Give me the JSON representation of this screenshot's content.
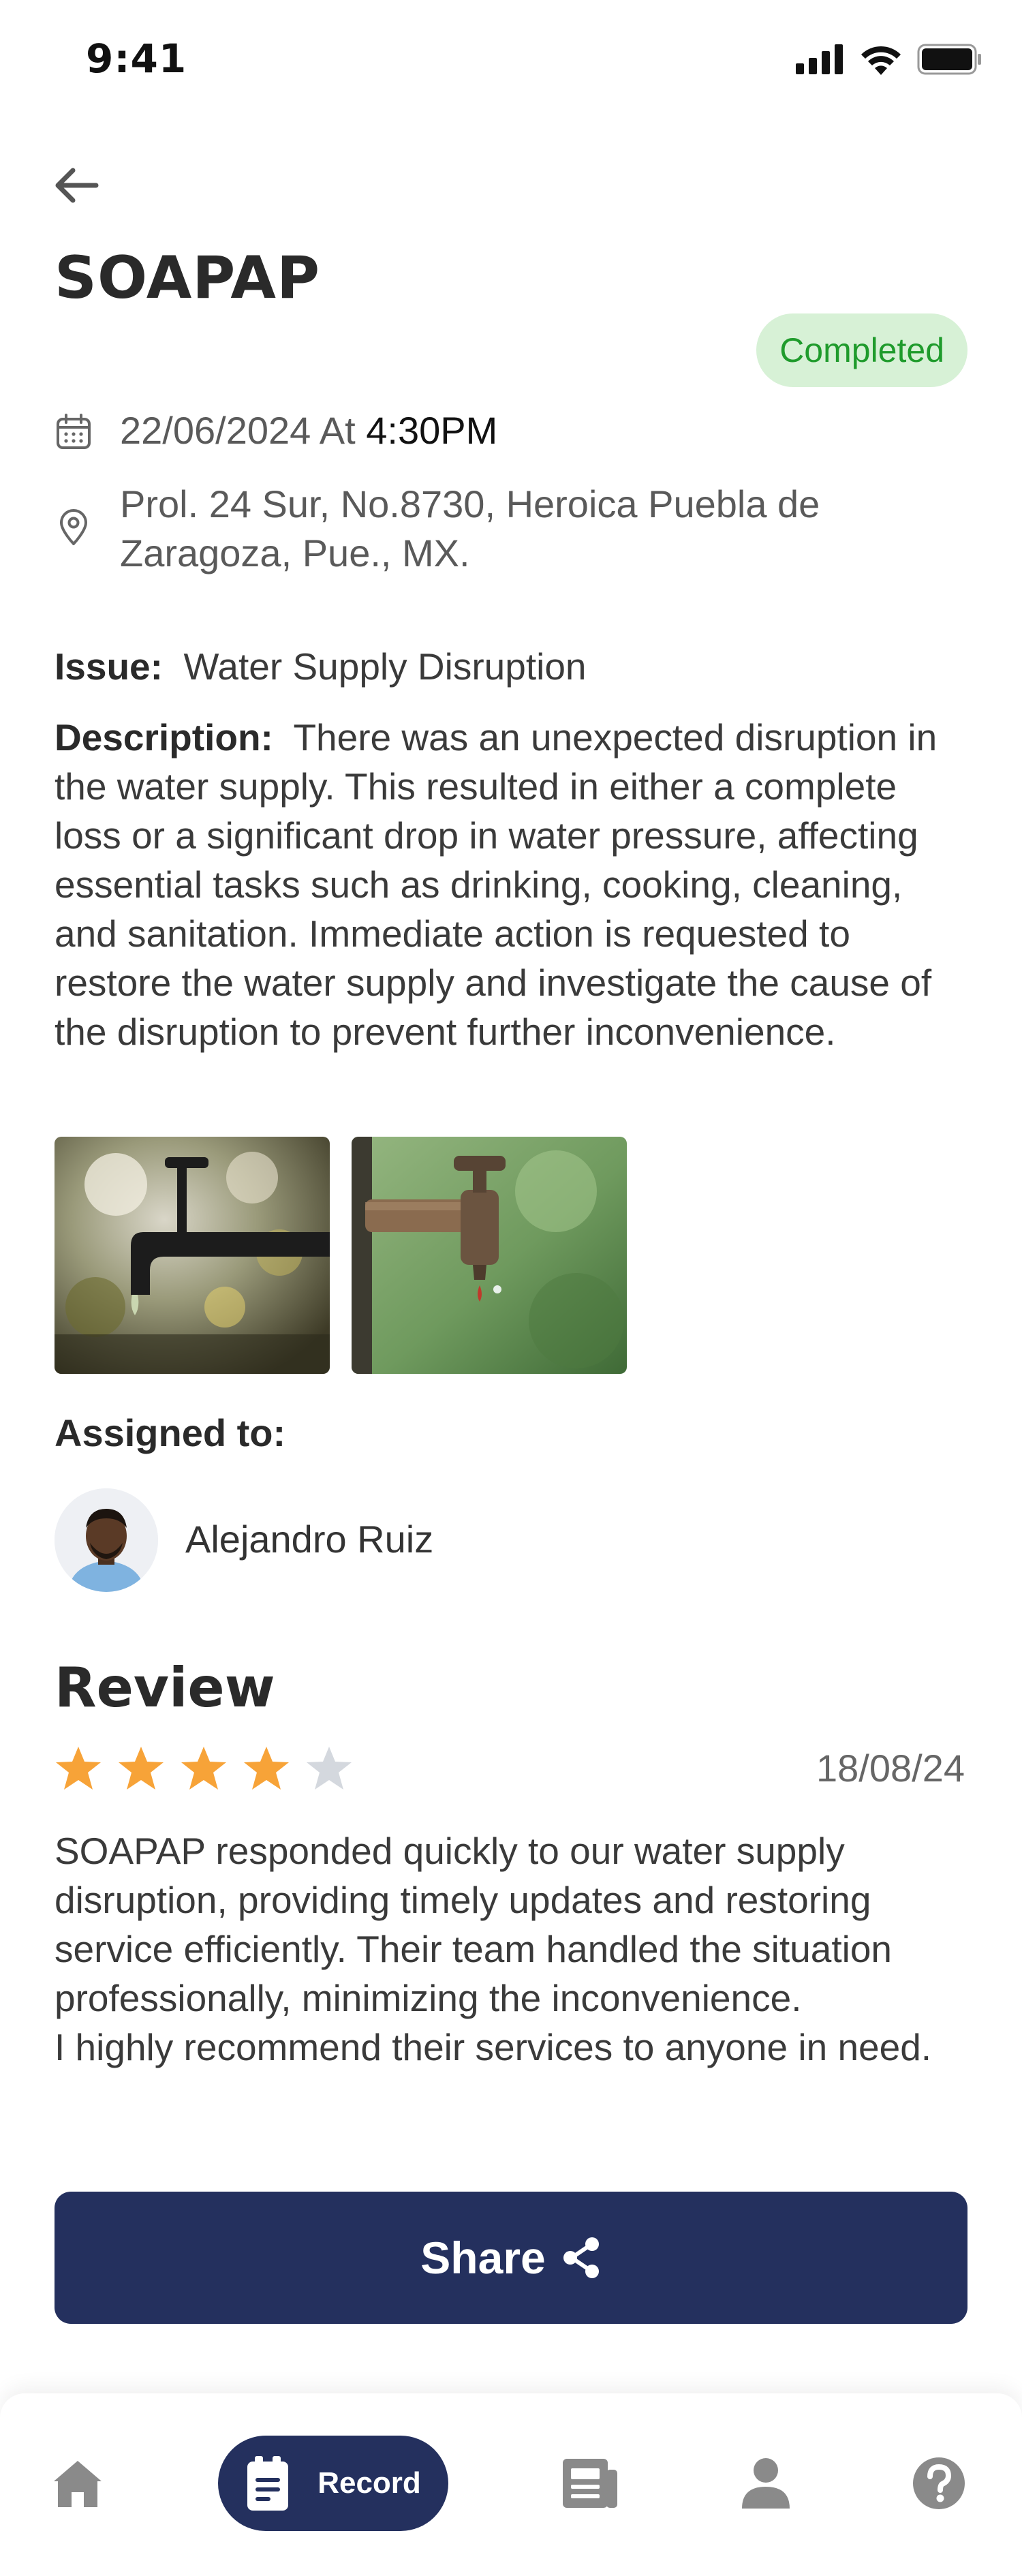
{
  "status_bar": {
    "time": "9:41"
  },
  "header": {
    "title": "SOAPAP",
    "status": "Completed"
  },
  "meta": {
    "date": "22/06/2024",
    "at": "At",
    "time": "4:30PM",
    "address_line1": "Prol. 24 Sur, No.8730, Heroica Puebla de",
    "address_line2": "Zaragoza, Pue., MX."
  },
  "issue": {
    "label": "Issue:",
    "value": "Water Supply Disruption"
  },
  "description": {
    "label": "Description:",
    "text": "There was an unexpected disruption in the water supply. This resulted in either a complete loss or a significant drop in water pressure, affecting essential tasks such as drinking, cooking, cleaning, and sanitation. Immediate action is requested to restore the water supply and investigate the cause of the disruption to prevent further inconvenience."
  },
  "assigned": {
    "label": "Assigned to:",
    "name": "Alejandro Ruiz"
  },
  "review": {
    "title": "Review",
    "rating": 4,
    "max_rating": 5,
    "date": "18/08/24",
    "text_line1": "SOAPAP  responded quickly to our water supply disruption, providing timely updates and restoring service efficiently. Their team handled the situation professionally, minimizing the inconvenience.",
    "text_line2": "I highly recommend their services to anyone in need."
  },
  "actions": {
    "share_label": "Share"
  },
  "nav": {
    "active_label": "Record"
  },
  "colors": {
    "accent": "#24305e",
    "badge_bg": "#d7f1d6",
    "badge_text": "#1f9b2c",
    "star": "#f7a338",
    "star_empty": "#d4d8de"
  }
}
